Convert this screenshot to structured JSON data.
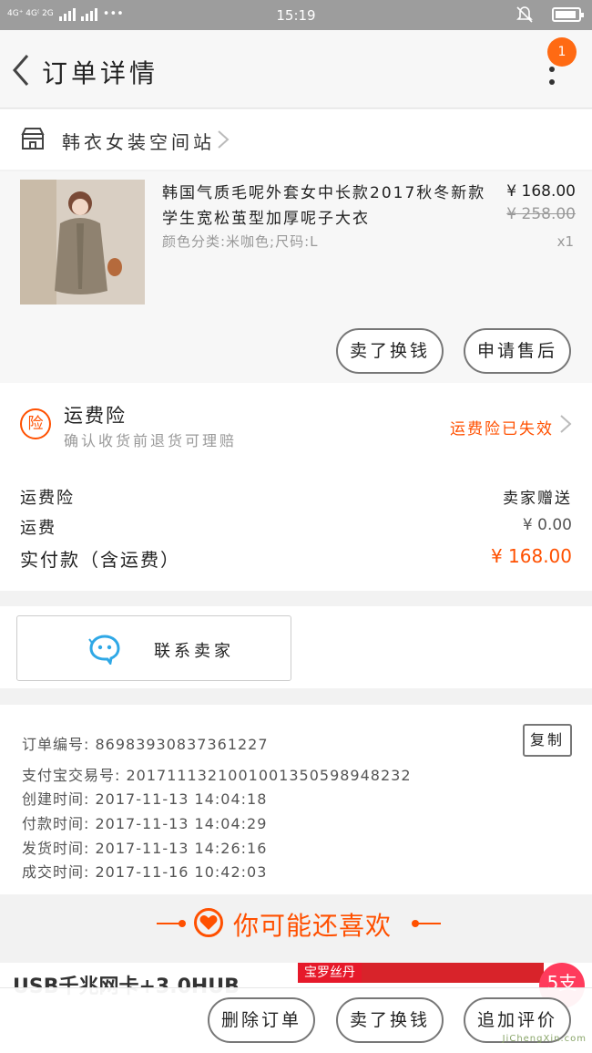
{
  "status_bar": {
    "network_left": "4G⁺ 4G⁽ 2G",
    "network_sub": "⁴⁵ 2G",
    "dots": "•••",
    "time": "15:19"
  },
  "nav": {
    "title": "订单详情",
    "badge": "1"
  },
  "shop": {
    "name": "韩衣女装空间站"
  },
  "item": {
    "title": "韩国气质毛呢外套女中长款2017秋冬新款学生宽松茧型加厚呢子大衣",
    "spec": "颜色分类:米咖色;尺码:L",
    "price": "¥ 168.00",
    "original_price": "¥ 258.00",
    "quantity": "x1",
    "buttons": {
      "resell": "卖了换钱",
      "after_sales": "申请售后"
    }
  },
  "insurance": {
    "icon_char": "险",
    "title": "运费险",
    "desc": "确认收货前退货可理赔",
    "status": "运费险已失效"
  },
  "fees": {
    "insurance_label": "运费险",
    "insurance_value": "卖家赠送",
    "shipping_label": "运费",
    "shipping_value": "¥ 0.00",
    "paid_label": "实付款（含运费）",
    "paid_value": "¥ 168.00"
  },
  "contact": {
    "label": "联系卖家"
  },
  "order_info": {
    "order_no": "订单编号: 86983930837361227",
    "alipay_no": "支付宝交易号: 2017111321001001350598948232",
    "created": "创建时间: 2017-11-13 14:04:18",
    "paid": "付款时间: 2017-11-13 14:04:29",
    "shipped": "发货时间: 2017-11-13 14:26:16",
    "completed": "成交时间: 2017-11-16 10:42:03",
    "copy_label": "复制"
  },
  "recommend": {
    "title": "你可能还喜欢"
  },
  "peek": {
    "title": "USB千兆网卡+3.0HUB",
    "brand": "宝罗丝丹",
    "badge": "5支"
  },
  "bottom_bar": {
    "delete": "删除订单",
    "resell": "卖了换钱",
    "review": "追加评价"
  },
  "watermark": {
    "text": "JiChengXin.com"
  },
  "colors": {
    "accent": "#ff5000",
    "badge": "#ff6a13",
    "status_bar": "#9d9d9d",
    "contact_icon": "#2fa8e6"
  }
}
